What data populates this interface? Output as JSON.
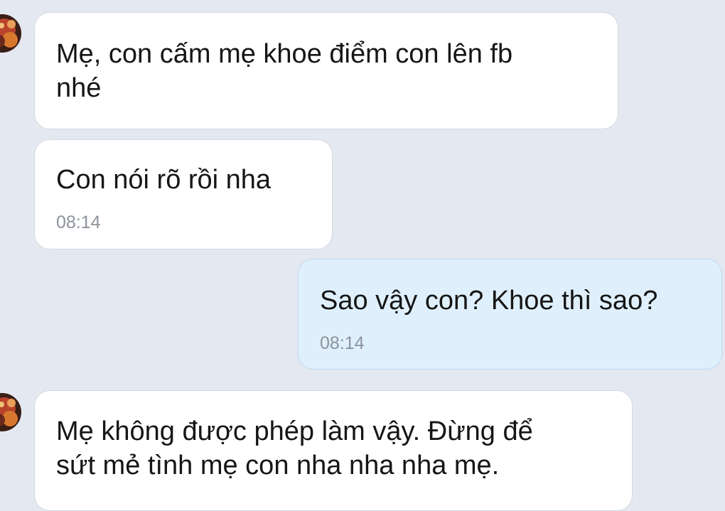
{
  "conversation": {
    "messages": [
      {
        "direction": "incoming",
        "text": "Mẹ, con cấm mẹ khoe điểm con lên fb\nnhé",
        "time": ""
      },
      {
        "direction": "incoming",
        "text": "Con nói rõ rồi nha",
        "time": "08:14"
      },
      {
        "direction": "outgoing",
        "text": "Sao vậy con? Khoe thì sao?",
        "time": "08:14"
      },
      {
        "direction": "incoming",
        "text": "Mẹ không được phép làm vậy. Đừng để\nsứt mẻ tình mẹ con nha nha nha mẹ.",
        "time": ""
      }
    ]
  },
  "colors": {
    "background": "#e4e8f1",
    "incoming_bubble": "#ffffff",
    "outgoing_bubble": "#dff0fc",
    "timestamp": "#8d939c"
  },
  "icons": {
    "avatar": "contact-avatar-photo"
  }
}
